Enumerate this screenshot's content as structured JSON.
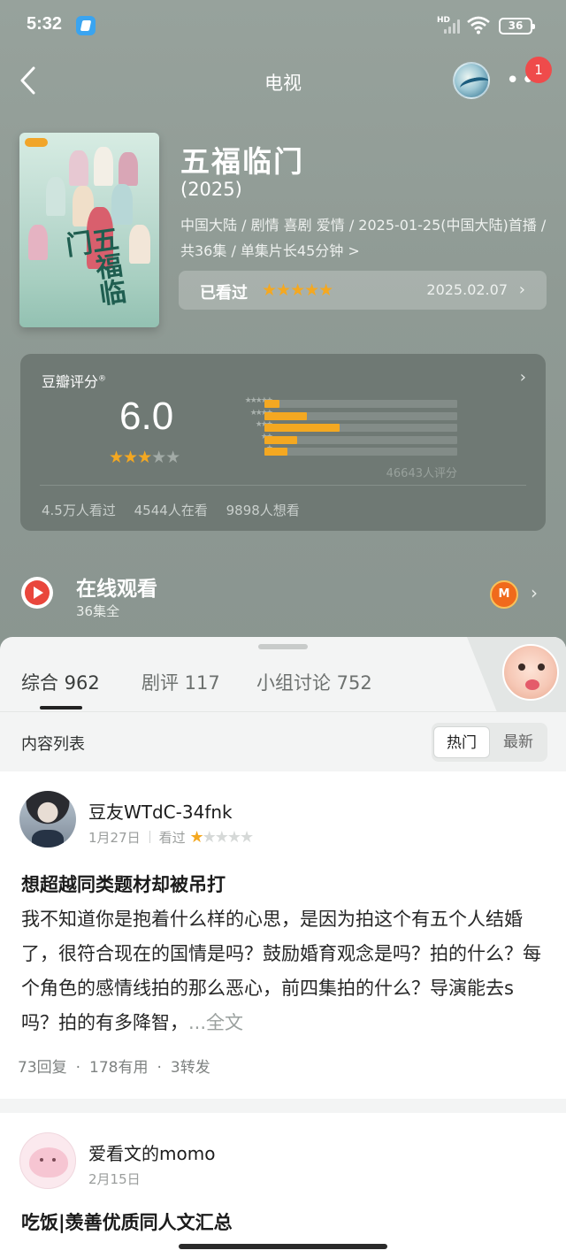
{
  "status_bar": {
    "time": "5:32",
    "network_label": "HD",
    "battery": "36"
  },
  "nav": {
    "title": "电视",
    "notification_count": "1",
    "more_glyph": "••"
  },
  "show": {
    "title": "五福临门",
    "year": "(2025)",
    "meta": "中国大陆 / 剧情 喜剧 爱情 / 2025-01-25(中国大陆)首播 / 共36集 / 单集片长45分钟 >",
    "watched_label": "已看过",
    "watched_stars": "★★★★★",
    "watched_date": "2025.02.07",
    "poster_text": "五福临门"
  },
  "rating": {
    "label": "豆瓣评分",
    "score": "6.0",
    "stars_on": "★★★",
    "stars_off": "★★",
    "distribution": [
      {
        "label": "★★★★★",
        "fraction": 0.08
      },
      {
        "label": "★★★★",
        "fraction": 0.22
      },
      {
        "label": "★★★",
        "fraction": 0.39
      },
      {
        "label": "★★",
        "fraction": 0.17
      },
      {
        "label": "★",
        "fraction": 0.12
      }
    ],
    "count": "46643人评分",
    "stats": [
      "4.5万人看过",
      "4544人在看",
      "9898人想看"
    ]
  },
  "online": {
    "title": "在线观看",
    "subtitle": "36集全",
    "provider_glyph": "M"
  },
  "tabs": [
    {
      "label": "综合 962"
    },
    {
      "label": "剧评 117"
    },
    {
      "label": "小组讨论 752"
    }
  ],
  "list": {
    "label": "内容列表",
    "sort_hot": "热门",
    "sort_new": "最新"
  },
  "reviews": [
    {
      "user": "豆友WTdC-34fnk",
      "date": "1月27日",
      "status": "看过",
      "stars_on": "★",
      "stars_off": "★★★★",
      "title": "想超越同类题材却被吊打",
      "body": "我不知道你是抱着什么样的心思，是因为拍这个有五个人结婚了，很符合现在的国情是吗？鼓励婚育观念是吗？拍的什么？每个角色的感情线拍的那么恶心，前四集拍的什么？导演能去s吗？拍的有多降智，",
      "more": "...全文",
      "replies": "73回复",
      "useful": "178有用",
      "shares": "3转发"
    },
    {
      "user": "爱看文的momo",
      "date": "2月15日",
      "title": "吃饭|羡善优质同人文汇总"
    }
  ],
  "colors": {
    "accent_star": "#f4a821",
    "hero_bg": "#919c96",
    "badge_red": "#ef4b4b"
  }
}
